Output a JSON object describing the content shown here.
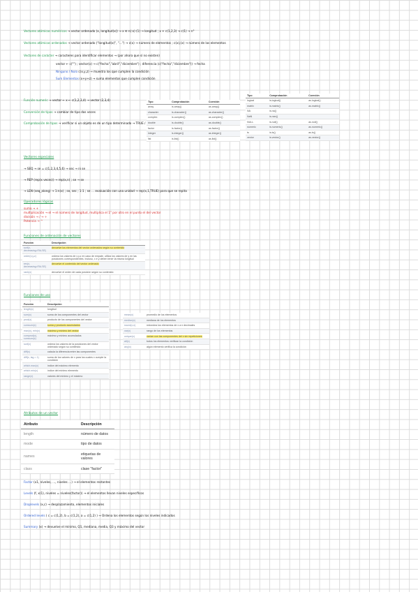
{
  "top_notes": [
    {
      "label": "Vectores atómicos numéricos",
      "text": "→ vector ordenado (x, longitud(x))  → x ∈ n(:x) (1)  → longitud ; x + c(1,2,3)  → c(1) → n°"
    },
    {
      "label": "Vectores atómicos ordenados",
      "text": "→ vector ordenado (\"longitud(x)\", \"…\")  → c(x) → número de elementos ; c(x),(x) → número de los elementos"
    },
    {
      "label": "Vectores de carácter",
      "text": "→ caracteres para identificar elementos → (por ahora que sí no existen)"
    },
    {
      "label": "",
      "text": "vector ← c(\"\") ; vector(x) → c(\"fecha\",\"abril\",\"diciembre\") ; diferencia (c(\"fecha\",\"diciembre\")) → fecha"
    },
    {
      "label": "Ninguno / Nulo",
      "text": "c(x,y,z) → muestra los que cumplen la condición"
    },
    {
      "label": "Sum Elementos",
      "text": "(x+y+z) → suma elementos que cumplen condición"
    }
  ],
  "middle_notes": [
    {
      "label": "Función numeric",
      "text": "→ vector ← x ← c(1,2,3,4) → vector (2,3,4)"
    },
    {
      "label": "Conversión de tipos",
      "text": "→ cambiar de tipo dos veces"
    },
    {
      "label": "Comprobación de tipos",
      "text": "→ verificar si un objeto es de un tipo determinado → TRUE / FALSE"
    }
  ],
  "type_table_left": {
    "headers": [
      "Tipo",
      "Comprobación",
      "Coerción"
    ],
    "rows": [
      [
        "array",
        "is.array()",
        "as.array()"
      ],
      [
        "character",
        "is.character()",
        "as.character()"
      ],
      [
        "complex",
        "is.complex()",
        "as.complex()"
      ],
      [
        "double",
        "is.double()",
        "as.double()"
      ],
      [
        "factor",
        "is.factor()",
        "as.factor()"
      ],
      [
        "integer",
        "is.integer()",
        "as.integer()"
      ],
      [
        "list",
        "is.list()",
        "as.list()"
      ]
    ]
  },
  "type_table_right": {
    "headers": [
      "Tipo",
      "Comprobación",
      "Coerción"
    ],
    "rows": [
      [
        "logical",
        "is.logical()",
        "as.logical()"
      ],
      [
        "matrix",
        "is.matrix()",
        "as.matrix()"
      ],
      [
        "NA",
        "is.na()",
        ""
      ],
      [
        "NaN",
        "is.nan()",
        ""
      ],
      [
        "NULL",
        "is.null()",
        "as.null()"
      ],
      [
        "numeric",
        "is.numeric()",
        "as.numeric()"
      ],
      [
        "ts",
        "is.ts()",
        "as.ts()"
      ],
      [
        "vector",
        "is.vector()",
        "as.vector()"
      ]
    ]
  },
  "vectores_especiales": {
    "title": "Vectores especiales",
    "lines": [
      "→ SEQ → se = c(1,2,3,4,5,6) → sec → ni se",
      "→ REP (rep(x veces)) → rep(x,n) ; se → se",
      "→ LEN (seq_along) → 1:n(x) ; se, sec ; 1:1 ; se … evaluación con una unidad → rep(x,1,TRUE) para que se repita"
    ]
  },
  "operadores": {
    "title": "Operadores lógicos",
    "lines": [
      "suma → +",
      "multiplicación → el → el número de longitud, multiplica el 1° por otro en el punto el del vector",
      "división → / → ÷",
      "Potencia → ^"
    ]
  },
  "ordenacion": {
    "title": "Funciones de ordenación de vectores",
    "headers": [
      "Función",
      "Descripción"
    ],
    "rows": [
      {
        "fn": "sort(x, decreasing=FALSE)",
        "desc": "devuelve los elementos del vector ordenados según su contenido"
      },
      {
        "fn": "order(x,y,z)",
        "desc": "ordena los valores de x,y,z en caso de empate, utiliza los valores de y en las posiciones correspondientes. Incluso, x e y deben tener la misma longitud"
      },
      {
        "fn": "rev(x, decreasing=FALSE)",
        "desc": "devuelve el contenido del vector ordenado"
      },
      {
        "fn": "rank(x)",
        "desc": "devuelve el orden de cada posición según su contenido"
      }
    ]
  },
  "funciones_uso": {
    "title": "Funciones de uso",
    "headers": [
      "Función",
      "Descripción"
    ],
    "rows": [
      [
        "length(x)",
        "longitud"
      ],
      [
        "sum(x)",
        "suma de los componentes del vector"
      ],
      [
        "prod(x)",
        "producto de los componentes del vector"
      ],
      [
        "cumsum(x)",
        "suma y producto acumulados"
      ],
      [
        "max(x), min(x)",
        "máximo y mínimo del vector"
      ],
      [
        "cumprod(x), cumsum(x)",
        "máximo y mínimo acumulados"
      ],
      [
        "sort(x)",
        "ordena los valores de la posiciones del vector ordenado según su contenido"
      ],
      [
        "diff(x)",
        "calcula la diferencia entre las componentes"
      ],
      [
        "diff(x, lag = 1)",
        "suma de los valores de x para los cuales x cumple la condición"
      ],
      [
        "which.max(x)",
        "índice del máximo elemento"
      ],
      [
        "which.min(x)",
        "índice del mínimo elemento"
      ],
      [
        "range(x)",
        "valores del mínimo y el máximo"
      ]
    ]
  },
  "funciones_uso_right": {
    "rows": [
      [
        "mean(x)",
        "promedio de los elementos"
      ],
      [
        "median(x)",
        "mediana de los elementos"
      ],
      [
        "round(x,n)",
        "redondea los elementos de x a n decimales"
      ],
      [
        "var(x)",
        "rango de los elementos"
      ],
      [
        "unique(x)",
        "varían con las componentes del x sin repeticiones"
      ],
      [
        "all(x)",
        "todos los elementos verifican la condición"
      ],
      [
        "any(x)",
        "algún elemento verifica la condición"
      ]
    ]
  },
  "atributos": {
    "title": "Atributos de un vector",
    "headers": [
      "Atributo",
      "Descripción"
    ],
    "rows": [
      [
        "length",
        "número de datos"
      ],
      [
        "mode",
        "tipo de datos"
      ],
      [
        "names",
        "etiquetas de valores"
      ],
      [
        "class",
        "clase \"factor\""
      ]
    ]
  },
  "bottom_lines": [
    {
      "k": "Factor",
      "text": "(x1, niveles, …, niveles …) → el elementos restantes"
    },
    {
      "k": "Levels",
      "text": "(f, x(1), niveles = niveles(factor)) → el elementos llevan niveles específicos"
    },
    {
      "k": "Droplevels",
      "text": "(x,c) → desplazamiento, elementos iniciales"
    },
    {
      "k": "Ordered levels",
      "text": "( c = c(1,2), b = c(1,2), a = c(1,2) ) → Ordena los elementos según los niveles indicados"
    },
    {
      "k": "Summary",
      "text": "(x) → devuelve el mínimo, Q1, mediana, media, Q3 y máximo del vector"
    }
  ],
  "colors": {
    "green": "#1f9a4d",
    "blue": "#2f5fd0",
    "red": "#d72c2c",
    "highlight": "#fff27a",
    "cyan": "#7fe0f0"
  }
}
